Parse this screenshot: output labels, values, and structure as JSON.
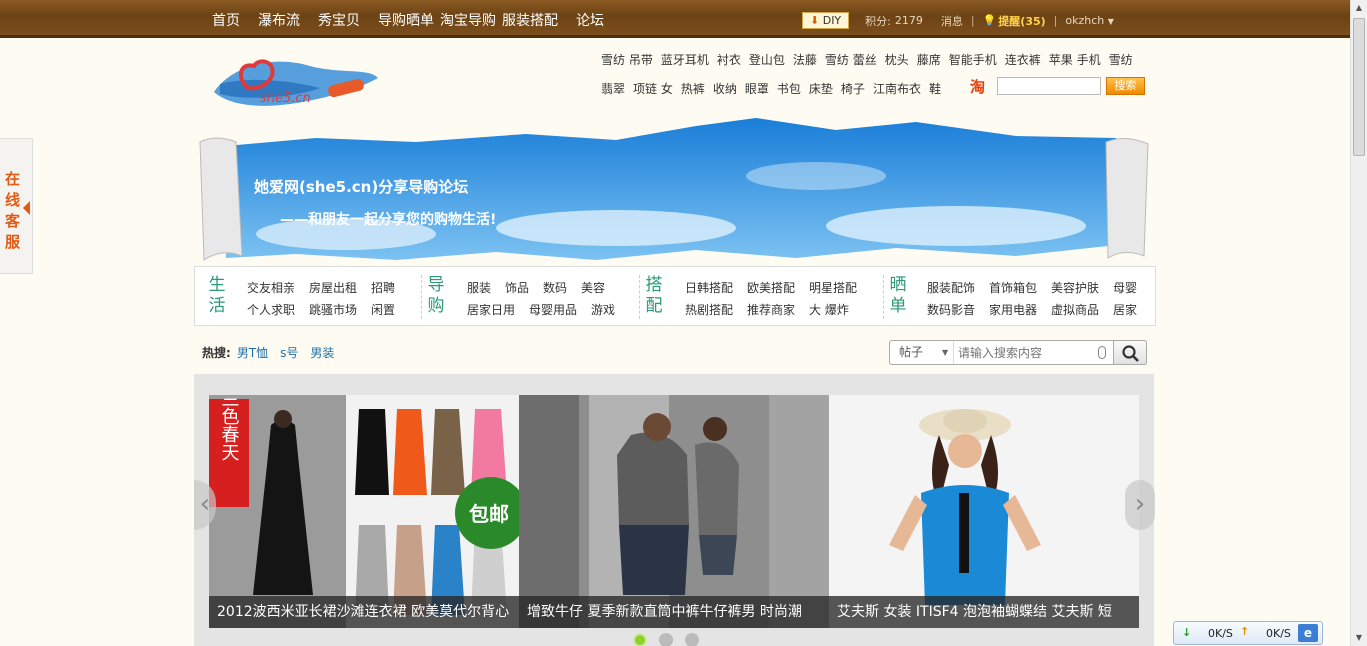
{
  "topbar": {
    "nav": [
      "首页",
      "瀑布流",
      "秀宝贝",
      "导购晒单",
      "淘宝导购",
      "服装搭配",
      "论坛"
    ],
    "diy_label": "DIY",
    "points_label": "积分:",
    "points_value": "2179",
    "messages_label": "消息",
    "remind_label": "提醒",
    "remind_count": "(35)",
    "username": "okzhch"
  },
  "logo": {
    "text": "she5.cn"
  },
  "keywords": {
    "row1": [
      "雪纺 吊带",
      "蓝牙耳机",
      "衬衣",
      "登山包",
      "法藤",
      "雪纺 蕾丝",
      "枕头",
      "藤席",
      "智能手机",
      "连衣裤",
      "苹果 手机",
      "雪纺"
    ],
    "row2": [
      "翡翠",
      "项链 女",
      "热裤",
      "收纳",
      "眼罩",
      "书包",
      "床垫",
      "椅子",
      "江南布衣",
      "鞋"
    ]
  },
  "taobao": {
    "icon_label": "淘",
    "button_label": "搜索"
  },
  "banner": {
    "title": "她爱网(she5.cn)分享导购论坛",
    "subtitle": "——和朋友一起分享您的购物生活!"
  },
  "categories": [
    {
      "title": "生活",
      "row1": [
        "交友相亲",
        "房屋出租",
        "招聘"
      ],
      "row2": [
        "个人求职",
        "跳骚市场",
        "闲置"
      ]
    },
    {
      "title": "导购",
      "row1": [
        "服装",
        "饰品",
        "数码",
        "美容"
      ],
      "row2": [
        "居家日用",
        "母婴用品",
        "游戏"
      ]
    },
    {
      "title": "搭配",
      "row1": [
        "日韩搭配",
        "欧美搭配",
        "明星搭配"
      ],
      "row2": [
        "热剧搭配",
        "推荐商家",
        "大 爆炸"
      ]
    },
    {
      "title": "晒单",
      "row1": [
        "服装配饰",
        "首饰箱包",
        "美容护肤",
        "母婴"
      ],
      "row2": [
        "数码影音",
        "家用电器",
        "虚拟商品",
        "居家"
      ]
    }
  ],
  "hot_search": {
    "label": "热搜:",
    "items": [
      "男T恤",
      "s号",
      "男装"
    ]
  },
  "search": {
    "select_value": "帖子",
    "placeholder": "请输入搜索内容"
  },
  "slides": [
    {
      "caption": "2012波西米亚长裙沙滩连衣裙 欧美莫代尔背心",
      "badge_text": "兰色春天",
      "tag_text": "包邮"
    },
    {
      "caption": "增致牛仔 夏季新款直筒中裤牛仔裤男 时尚潮"
    },
    {
      "caption": "艾夫斯 女装 ITISF4 泡泡袖蝴蝶结 艾夫斯 短"
    }
  ],
  "service": {
    "label": "在线客服"
  },
  "speed": {
    "down": "0K/S",
    "up": "0K/S"
  },
  "colors": {
    "topbar": "#7b4e1b",
    "accent": "#2a9a78",
    "link": "#1e6fa8",
    "orange": "#e25b15"
  }
}
